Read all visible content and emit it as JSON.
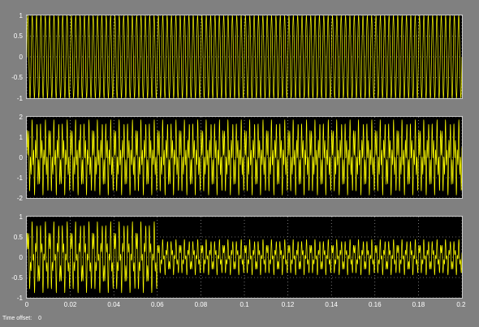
{
  "window": {
    "time_offset_label": "Time offset:",
    "time_offset_value": "0"
  },
  "colors": {
    "background": "#808080",
    "axes_bg": "#000000",
    "signal": "#ffff00",
    "grid": "#c8c8c8",
    "text": "#ffffff"
  },
  "chart_data": [
    {
      "type": "line",
      "title": "",
      "xlabel": "",
      "ylabel": "",
      "xlim": [
        0,
        0.2
      ],
      "ylim": [
        -1,
        1
      ],
      "grid": true,
      "ytick_labels": [
        "1",
        "0.5",
        "0",
        "-0.5",
        "-1"
      ],
      "ytick_values": [
        1,
        0.5,
        0,
        -0.5,
        -1
      ],
      "series": [
        {
          "components": [
            {
              "amp": 1.0,
              "freq": 500,
              "phase": 0
            }
          ]
        }
      ]
    },
    {
      "type": "line",
      "title": "",
      "xlabel": "",
      "ylabel": "",
      "xlim": [
        0,
        0.2
      ],
      "ylim": [
        -2,
        2
      ],
      "grid": true,
      "ytick_labels": [
        "2",
        "1",
        "0",
        "-1",
        "-2"
      ],
      "ytick_values": [
        2,
        1,
        0,
        -1,
        -2
      ],
      "series": [
        {
          "components": [
            {
              "amp": 1.0,
              "freq": 500,
              "phase": 0
            },
            {
              "amp": 0.9,
              "freq": 1300,
              "phase": 0.6
            }
          ]
        }
      ]
    },
    {
      "type": "line",
      "title": "",
      "xlabel": "",
      "ylabel": "",
      "xlim": [
        0,
        0.2
      ],
      "ylim": [
        -1,
        1
      ],
      "grid": true,
      "ytick_labels": [
        "1",
        "0.5",
        "0",
        "-0.5",
        "-1"
      ],
      "ytick_values": [
        1,
        0.5,
        0,
        -0.5,
        -1
      ],
      "xtick_labels": [
        "0",
        "0.02",
        "0.04",
        "0.06",
        "0.08",
        "0.1",
        "0.12",
        "0.14",
        "0.16",
        "0.18",
        "0.2"
      ],
      "xtick_values": [
        0,
        0.02,
        0.04,
        0.06,
        0.08,
        0.1,
        0.12,
        0.14,
        0.16,
        0.18,
        0.2
      ],
      "series": [
        {
          "components": [
            {
              "amp": 0.55,
              "freq": 500,
              "phase": 0
            },
            {
              "amp": 0.35,
              "freq": 1300,
              "phase": 0.6
            }
          ],
          "envelope": {
            "early_amp": 0.9,
            "late_amp": 0.45,
            "transition_t": 0.06
          }
        }
      ]
    }
  ]
}
